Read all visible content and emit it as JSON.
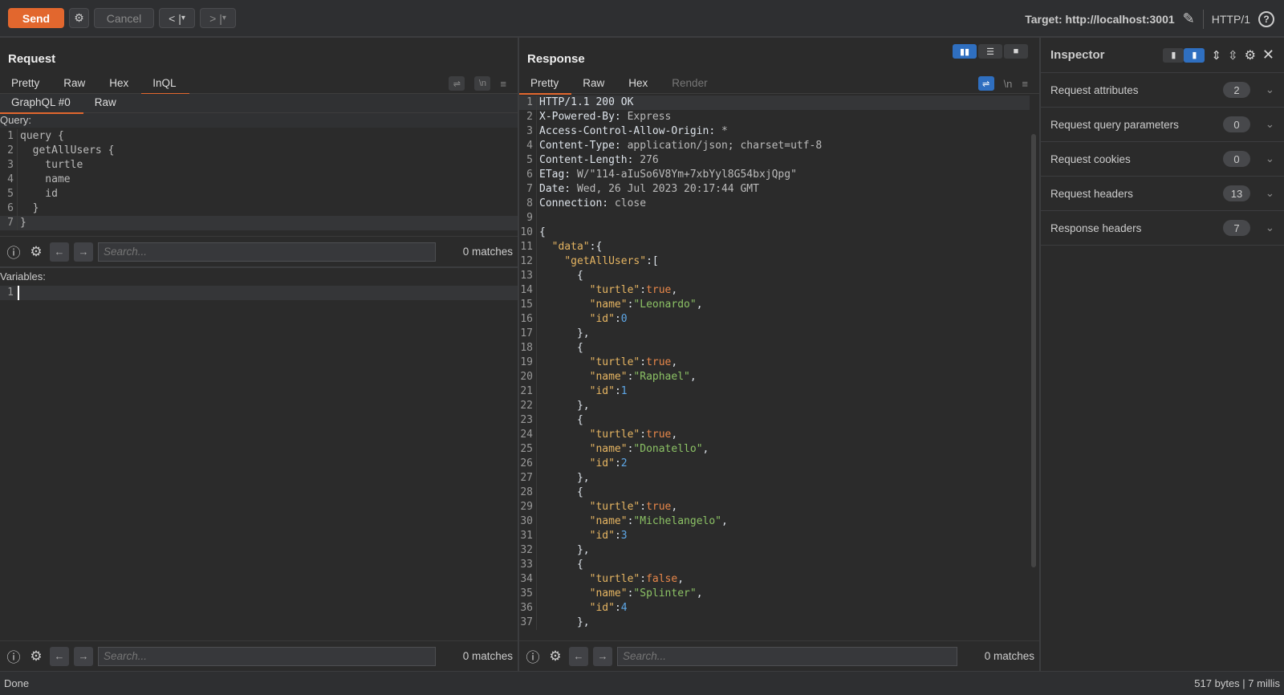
{
  "toolbar": {
    "send": "Send",
    "cancel": "Cancel",
    "prev": "<",
    "next": ">",
    "dropdown": "▾",
    "target": "Target: http://localhost:3001",
    "protocol": "HTTP/1"
  },
  "request": {
    "title": "Request",
    "tabs": [
      "Pretty",
      "Raw",
      "Hex",
      "InQL"
    ],
    "subtabs": [
      "GraphQL #0",
      "Raw"
    ],
    "query_label": "Query:",
    "query_lines": [
      [
        [
          "v",
          "query {"
        ]
      ],
      [
        [
          "v",
          "  getAllUsers {"
        ]
      ],
      [
        [
          "v",
          "    turtle"
        ]
      ],
      [
        [
          "v",
          "    name"
        ]
      ],
      [
        [
          "v",
          "    id"
        ]
      ],
      [
        [
          "v",
          "  }"
        ]
      ],
      [
        [
          "v",
          "}"
        ]
      ]
    ],
    "variables_label": "Variables:",
    "variables_lines": [
      [
        [
          "v",
          ""
        ]
      ]
    ],
    "search": {
      "placeholder": "Search...",
      "matches": "0 matches"
    }
  },
  "response": {
    "title": "Response",
    "tabs": [
      "Pretty",
      "Raw",
      "Hex",
      "Render"
    ],
    "lines": [
      [
        [
          "h",
          "HTTP/1.1 200 OK"
        ]
      ],
      [
        [
          "h",
          "X-Powered-By:"
        ],
        [
          "v",
          " Express"
        ]
      ],
      [
        [
          "h",
          "Access-Control-Allow-Origin:"
        ],
        [
          "v",
          " *"
        ]
      ],
      [
        [
          "h",
          "Content-Type:"
        ],
        [
          "v",
          " application/json; charset=utf-8"
        ]
      ],
      [
        [
          "h",
          "Content-Length:"
        ],
        [
          "v",
          " 276"
        ]
      ],
      [
        [
          "h",
          "ETag:"
        ],
        [
          "v",
          " W/\"114-aIuSo6V8Ym+7xbYyl8G54bxjQpg\""
        ]
      ],
      [
        [
          "h",
          "Date:"
        ],
        [
          "v",
          " Wed, 26 Jul 2023 20:17:44 GMT"
        ]
      ],
      [
        [
          "h",
          "Connection:"
        ],
        [
          "v",
          " close"
        ]
      ],
      [
        [
          "v",
          ""
        ]
      ],
      [
        [
          "h",
          "{"
        ]
      ],
      [
        [
          "v",
          "  "
        ],
        [
          "k",
          "\"data\""
        ],
        [
          "h",
          ":{"
        ]
      ],
      [
        [
          "v",
          "    "
        ],
        [
          "k",
          "\"getAllUsers\""
        ],
        [
          "h",
          ":["
        ]
      ],
      [
        [
          "h",
          "      {"
        ]
      ],
      [
        [
          "v",
          "        "
        ],
        [
          "k",
          "\"turtle\""
        ],
        [
          "h",
          ":"
        ],
        [
          "b",
          "true"
        ],
        [
          "h",
          ","
        ]
      ],
      [
        [
          "v",
          "        "
        ],
        [
          "k",
          "\"name\""
        ],
        [
          "h",
          ":"
        ],
        [
          "s",
          "\"Leonardo\""
        ],
        [
          "h",
          ","
        ]
      ],
      [
        [
          "v",
          "        "
        ],
        [
          "k",
          "\"id\""
        ],
        [
          "h",
          ":"
        ],
        [
          "n",
          "0"
        ]
      ],
      [
        [
          "h",
          "      },"
        ]
      ],
      [
        [
          "h",
          "      {"
        ]
      ],
      [
        [
          "v",
          "        "
        ],
        [
          "k",
          "\"turtle\""
        ],
        [
          "h",
          ":"
        ],
        [
          "b",
          "true"
        ],
        [
          "h",
          ","
        ]
      ],
      [
        [
          "v",
          "        "
        ],
        [
          "k",
          "\"name\""
        ],
        [
          "h",
          ":"
        ],
        [
          "s",
          "\"Raphael\""
        ],
        [
          "h",
          ","
        ]
      ],
      [
        [
          "v",
          "        "
        ],
        [
          "k",
          "\"id\""
        ],
        [
          "h",
          ":"
        ],
        [
          "n",
          "1"
        ]
      ],
      [
        [
          "h",
          "      },"
        ]
      ],
      [
        [
          "h",
          "      {"
        ]
      ],
      [
        [
          "v",
          "        "
        ],
        [
          "k",
          "\"turtle\""
        ],
        [
          "h",
          ":"
        ],
        [
          "b",
          "true"
        ],
        [
          "h",
          ","
        ]
      ],
      [
        [
          "v",
          "        "
        ],
        [
          "k",
          "\"name\""
        ],
        [
          "h",
          ":"
        ],
        [
          "s",
          "\"Donatello\""
        ],
        [
          "h",
          ","
        ]
      ],
      [
        [
          "v",
          "        "
        ],
        [
          "k",
          "\"id\""
        ],
        [
          "h",
          ":"
        ],
        [
          "n",
          "2"
        ]
      ],
      [
        [
          "h",
          "      },"
        ]
      ],
      [
        [
          "h",
          "      {"
        ]
      ],
      [
        [
          "v",
          "        "
        ],
        [
          "k",
          "\"turtle\""
        ],
        [
          "h",
          ":"
        ],
        [
          "b",
          "true"
        ],
        [
          "h",
          ","
        ]
      ],
      [
        [
          "v",
          "        "
        ],
        [
          "k",
          "\"name\""
        ],
        [
          "h",
          ":"
        ],
        [
          "s",
          "\"Michelangelo\""
        ],
        [
          "h",
          ","
        ]
      ],
      [
        [
          "v",
          "        "
        ],
        [
          "k",
          "\"id\""
        ],
        [
          "h",
          ":"
        ],
        [
          "n",
          "3"
        ]
      ],
      [
        [
          "h",
          "      },"
        ]
      ],
      [
        [
          "h",
          "      {"
        ]
      ],
      [
        [
          "v",
          "        "
        ],
        [
          "k",
          "\"turtle\""
        ],
        [
          "h",
          ":"
        ],
        [
          "b",
          "false"
        ],
        [
          "h",
          ","
        ]
      ],
      [
        [
          "v",
          "        "
        ],
        [
          "k",
          "\"name\""
        ],
        [
          "h",
          ":"
        ],
        [
          "s",
          "\"Splinter\""
        ],
        [
          "h",
          ","
        ]
      ],
      [
        [
          "v",
          "        "
        ],
        [
          "k",
          "\"id\""
        ],
        [
          "h",
          ":"
        ],
        [
          "n",
          "4"
        ]
      ],
      [
        [
          "h",
          "      },"
        ]
      ]
    ],
    "search": {
      "placeholder": "Search...",
      "matches": "0 matches"
    }
  },
  "inspector": {
    "title": "Inspector",
    "rows": [
      {
        "label": "Request attributes",
        "count": "2"
      },
      {
        "label": "Request query parameters",
        "count": "0"
      },
      {
        "label": "Request cookies",
        "count": "0"
      },
      {
        "label": "Request headers",
        "count": "13"
      },
      {
        "label": "Response headers",
        "count": "7"
      }
    ]
  },
  "status": {
    "left": "Done",
    "right": "517 bytes | 7 millis"
  },
  "colors": {
    "accent": "#e2672e",
    "selected": "#2f6fc0",
    "json_key": "#e6b562",
    "json_string": "#8cc265",
    "json_bool": "#e8874a",
    "json_number": "#5ea8e8"
  }
}
